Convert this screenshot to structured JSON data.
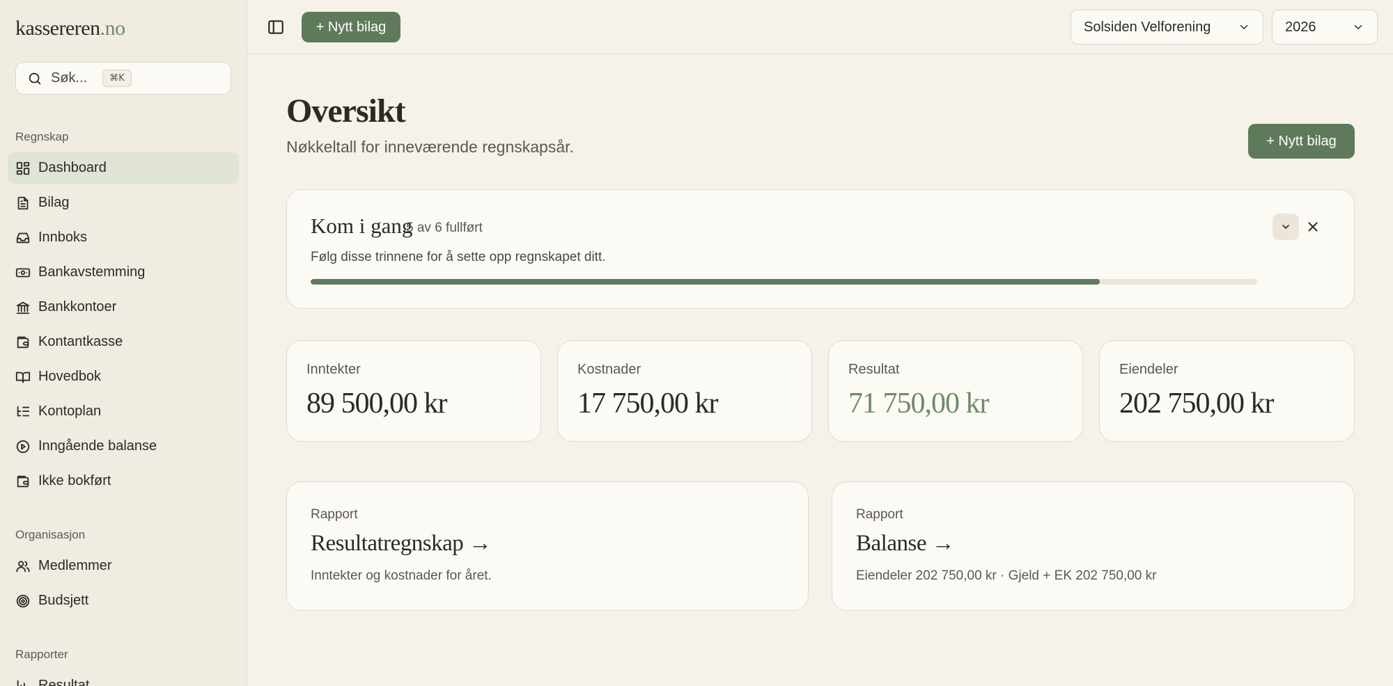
{
  "brand": {
    "name": "kassereren",
    "tld": ".no"
  },
  "search": {
    "placeholder": "Søk...",
    "shortcut": "⌘K"
  },
  "sidebar": {
    "sections": [
      {
        "label": "Regnskap",
        "items": [
          {
            "label": "Dashboard",
            "icon": "dashboard-icon",
            "active": true
          },
          {
            "label": "Bilag",
            "icon": "file-text-icon"
          },
          {
            "label": "Innboks",
            "icon": "inbox-icon"
          },
          {
            "label": "Bankavstemming",
            "icon": "banknote-icon"
          },
          {
            "label": "Bankkontoer",
            "icon": "bank-icon"
          },
          {
            "label": "Kontantkasse",
            "icon": "wallet-icon"
          },
          {
            "label": "Hovedbok",
            "icon": "book-open-icon"
          },
          {
            "label": "Kontoplan",
            "icon": "list-tree-icon"
          },
          {
            "label": "Inngående balanse",
            "icon": "play-circle-icon"
          },
          {
            "label": "Ikke bokført",
            "icon": "wallet-icon"
          }
        ]
      },
      {
        "label": "Organisasjon",
        "items": [
          {
            "label": "Medlemmer",
            "icon": "users-icon"
          },
          {
            "label": "Budsjett",
            "icon": "target-icon"
          }
        ]
      },
      {
        "label": "Rapporter",
        "items": [
          {
            "label": "Resultat",
            "icon": "bar-chart-icon"
          }
        ]
      }
    ]
  },
  "topbar": {
    "new_voucher_label": "+ Nytt bilag",
    "organization": "Solsiden Velforening",
    "year": "2026"
  },
  "page": {
    "title": "Oversikt",
    "subtitle": "Nøkkeltall for inneværende regnskapsår.",
    "new_voucher_label": "+ Nytt bilag"
  },
  "getting_started": {
    "title": "Kom i gang",
    "count": "5 av 6 fullført",
    "description": "Følg disse trinnene for å sette opp regnskapet ditt.",
    "completed": 5,
    "total": 6
  },
  "stats": [
    {
      "label": "Inntekter",
      "value": "89 500,00 kr"
    },
    {
      "label": "Kostnader",
      "value": "17 750,00 kr"
    },
    {
      "label": "Resultat",
      "value": "71 750,00 kr",
      "accent": "#6f8a68"
    },
    {
      "label": "Eiendeler",
      "value": "202 750,00 kr"
    }
  ],
  "reports": [
    {
      "kicker": "Rapport",
      "title": "Resultatregnskap →",
      "description": "Inntekter og kostnader for året."
    },
    {
      "kicker": "Rapport",
      "title": "Balanse →",
      "description": "Eiendeler 202 750,00 kr · Gjeld + EK 202 750,00 kr"
    }
  ],
  "colors": {
    "accent": "#5f7a5b",
    "accent_text": "#6f8a68",
    "background": "#f6f2ea",
    "sidebar": "#f1ece2",
    "card": "#fcfaf5"
  }
}
